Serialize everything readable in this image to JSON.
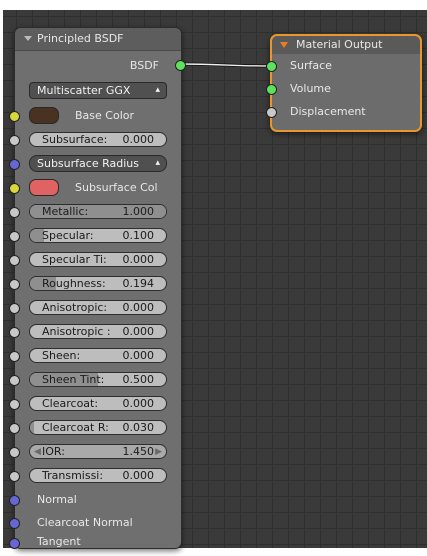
{
  "bsdf_node": {
    "title": "Principled BSDF",
    "output_label": "BSDF",
    "distribution": "Multiscatter GGX",
    "base_color_label": "Base Color",
    "base_color": "#4a3222",
    "subsurface": {
      "label": "Subsurface:",
      "value": "0.000"
    },
    "subsurface_method": "Subsurface Radius",
    "subsurface_color_label": "Subsurface Col",
    "subsurface_color": "#e06262",
    "fields": [
      {
        "label": "Metallic:",
        "value": "1.000",
        "fill": 1.0
      },
      {
        "label": "Specular:",
        "value": "0.100",
        "fill": 0.1
      },
      {
        "label": "Specular Ti:",
        "value": "0.000",
        "fill": 0.0
      },
      {
        "label": "Roughness:",
        "value": "0.194",
        "fill": 0.194
      },
      {
        "label": "Anisotropic:",
        "value": "0.000",
        "fill": 0.0
      },
      {
        "label": "Anisotropic :",
        "value": "0.000",
        "fill": 0.0
      },
      {
        "label": "Sheen:",
        "value": "0.000",
        "fill": 0.0
      },
      {
        "label": "Sheen Tint:",
        "value": "0.500",
        "fill": 0.5
      },
      {
        "label": "Clearcoat:",
        "value": "0.000",
        "fill": 0.0
      },
      {
        "label": "Clearcoat R:",
        "value": "0.030",
        "fill": 0.03
      }
    ],
    "ior": {
      "label": "IOR:",
      "value": "1.450"
    },
    "transmission": {
      "label": "Transmissi:",
      "value": "0.000"
    },
    "vector_inputs": [
      "Normal",
      "Clearcoat Normal",
      "Tangent"
    ]
  },
  "material_output_node": {
    "title": "Material Output",
    "inputs": [
      "Surface",
      "Volume",
      "Displacement"
    ]
  },
  "colors": {
    "output_socket": "#5ee25e",
    "selected_outline": "#e8982a",
    "header_arrow": "#f07d1c"
  }
}
